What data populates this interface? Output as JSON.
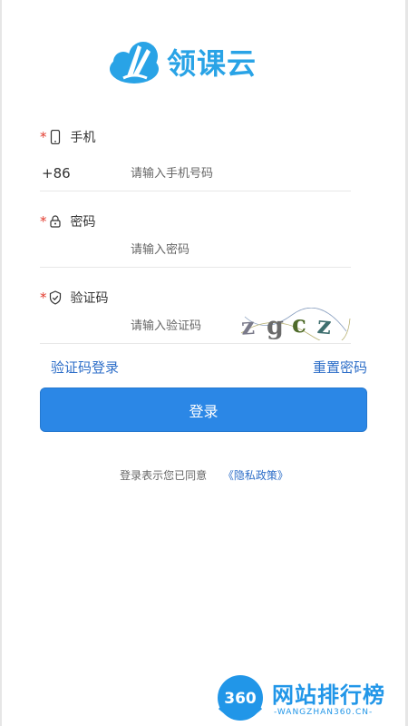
{
  "brand": {
    "name": "领课云",
    "color": "#29a3e6",
    "icon": "cloud-book-logo"
  },
  "form": {
    "required_mark": "*",
    "phone": {
      "label": "手机",
      "icon": "phone-icon",
      "prefix": "+86",
      "placeholder": "请输入手机号码",
      "value": ""
    },
    "password": {
      "label": "密码",
      "icon": "lock-icon",
      "placeholder": "请输入密码",
      "value": ""
    },
    "captcha": {
      "label": "验证码",
      "icon": "shield-check-icon",
      "placeholder": "请输入验证码",
      "value": "",
      "image_text": "zgcz"
    }
  },
  "links": {
    "sms_login": "验证码登录",
    "reset_password": "重置密码"
  },
  "login_button": {
    "label": "登录",
    "color": "#2b87e6"
  },
  "agreement": {
    "text": "登录表示您已同意",
    "policy": "《隐私政策》"
  },
  "watermark": {
    "badge": "360",
    "title": "网站排行榜",
    "url": "-WANGZHAN360.CN-"
  }
}
